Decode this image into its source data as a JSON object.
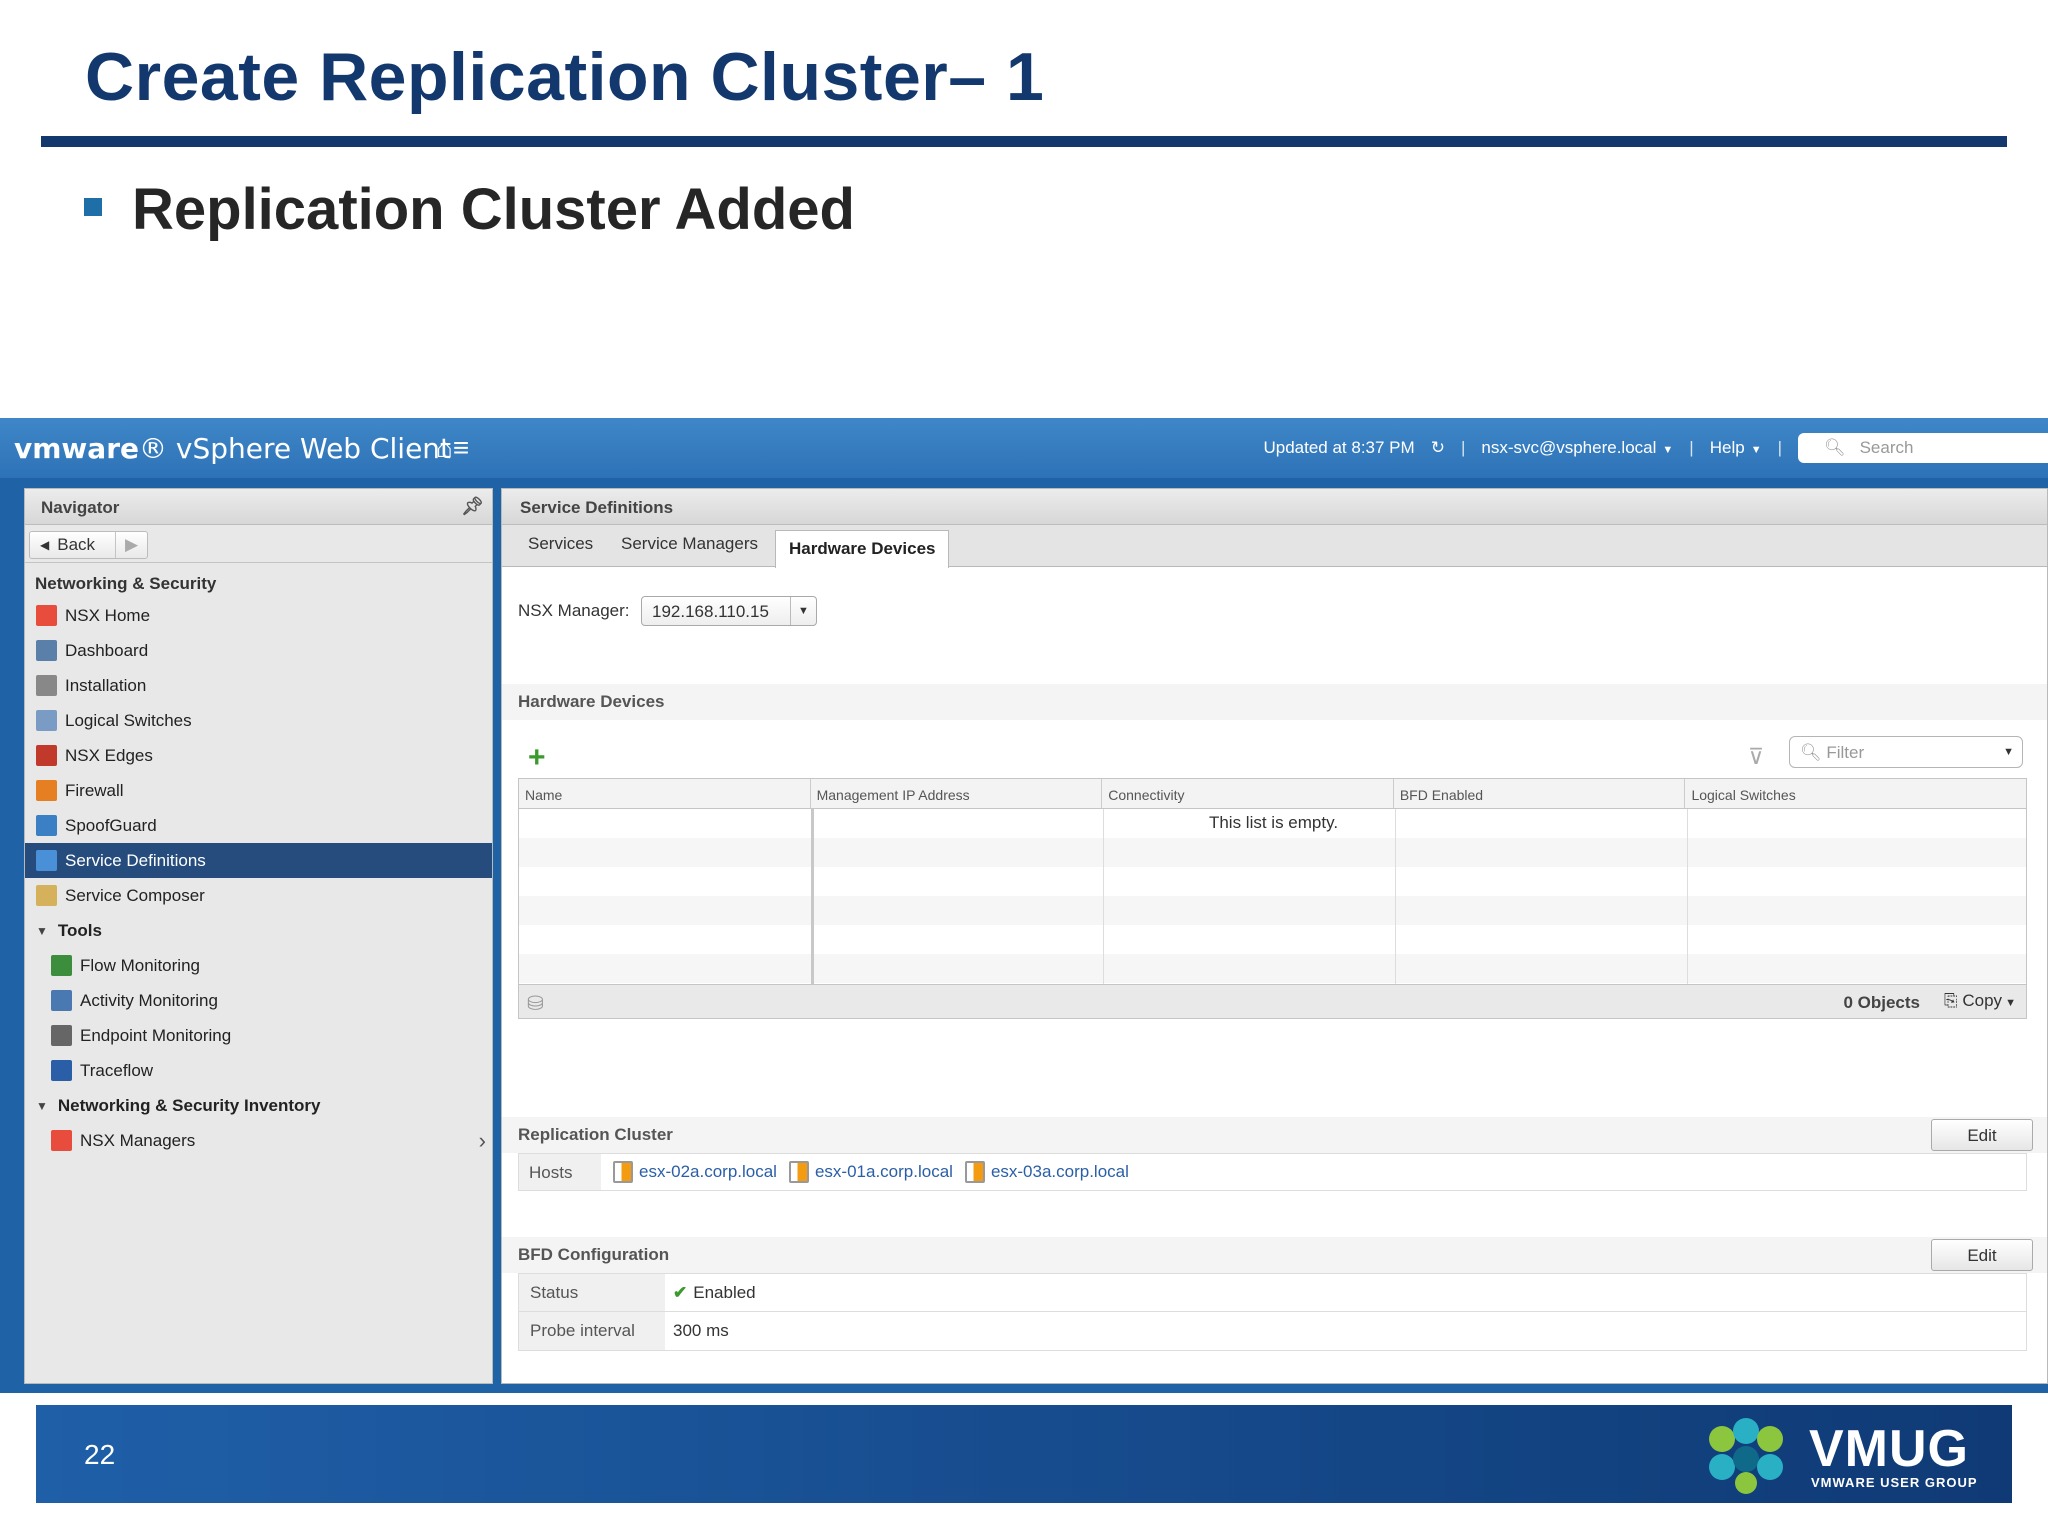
{
  "slide": {
    "title": "Create Replication Cluster– 1",
    "bullet": "Replication Cluster Added",
    "page_number": "22",
    "footer_logo": "VMUG",
    "footer_logo_sub": "VMWARE USER GROUP"
  },
  "app": {
    "brand": "vmware",
    "product": "vSphere Web Client",
    "updated": "Updated at 8:37 PM",
    "user": "nsx-svc@vsphere.local",
    "help": "Help",
    "search_placeholder": "Search"
  },
  "navigator": {
    "title": "Navigator",
    "back": "Back",
    "section": "Networking & Security",
    "items": [
      {
        "label": "NSX Home",
        "color": "#e74c3c"
      },
      {
        "label": "Dashboard",
        "color": "#5a7fa8"
      },
      {
        "label": "Installation",
        "color": "#888888"
      },
      {
        "label": "Logical Switches",
        "color": "#7a9cc4"
      },
      {
        "label": "NSX Edges",
        "color": "#c0392b"
      },
      {
        "label": "Firewall",
        "color": "#e67e22"
      },
      {
        "label": "SpoofGuard",
        "color": "#3b7fc4"
      },
      {
        "label": "Service Definitions",
        "color": "#4a90d9"
      },
      {
        "label": "Service Composer",
        "color": "#d4b15a"
      }
    ],
    "tools_label": "Tools",
    "tools": [
      {
        "label": "Flow Monitoring",
        "color": "#3c8d3c"
      },
      {
        "label": "Activity Monitoring",
        "color": "#4a78b0"
      },
      {
        "label": "Endpoint Monitoring",
        "color": "#666666"
      },
      {
        "label": "Traceflow",
        "color": "#2a5fa7"
      }
    ],
    "inventory_label": "Networking & Security Inventory",
    "inventory": [
      {
        "label": "NSX Managers",
        "color": "#e74c3c"
      }
    ]
  },
  "main": {
    "title": "Service Definitions",
    "tabs": [
      "Services",
      "Service Managers",
      "Hardware Devices"
    ],
    "nsx_manager_label": "NSX Manager:",
    "nsx_manager_value": "192.168.110.15",
    "hw_section": "Hardware Devices",
    "filter_placeholder": "Filter",
    "columns": [
      "Name",
      "Management IP Address",
      "Connectivity",
      "BFD Enabled",
      "Logical Switches"
    ],
    "empty_text": "This list is empty.",
    "objects": "0 Objects",
    "copy": "Copy",
    "replication_section": "Replication Cluster",
    "edit": "Edit",
    "hosts_label": "Hosts",
    "hosts": [
      "esx-02a.corp.local",
      "esx-01a.corp.local",
      "esx-03a.corp.local"
    ],
    "bfd_section": "BFD Configuration",
    "bfd_status_label": "Status",
    "bfd_status_value": "Enabled",
    "bfd_probe_label": "Probe interval",
    "bfd_probe_value": "300 ms"
  }
}
